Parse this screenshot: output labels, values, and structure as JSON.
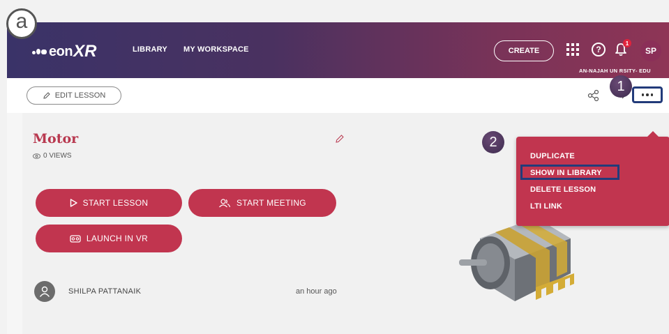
{
  "markers": {
    "a": "a",
    "step1": "1",
    "step2": "2"
  },
  "header": {
    "logo_text": "eon",
    "logo_xr": "XR",
    "nav": [
      "LIBRARY",
      "MY WORKSPACE"
    ],
    "create_label": "CREATE",
    "help_glyph": "?",
    "notification_count": "1",
    "avatar_initials": "SP",
    "org": "AN-NAJAH UN   RSITY- EDU"
  },
  "toolbar": {
    "edit_label": "EDIT LESSON",
    "icons": [
      "share-icon",
      "share-icon",
      "more-icon"
    ]
  },
  "lesson": {
    "title": "Motor",
    "views": "0 VIEWS",
    "start_lesson": "START LESSON",
    "start_meeting": "START MEETING",
    "launch_vr": "LAUNCH IN VR",
    "author": "SHILPA PATTANAIK",
    "time": "an hour ago"
  },
  "menu": {
    "items": [
      "DUPLICATE",
      "SHOW IN LIBRARY",
      "DELETE LESSON",
      "LTI LINK"
    ]
  },
  "colors": {
    "brand": "#c1354f",
    "header_start": "#3a3368",
    "header_end": "#8e3556",
    "highlight": "#223b7a"
  }
}
